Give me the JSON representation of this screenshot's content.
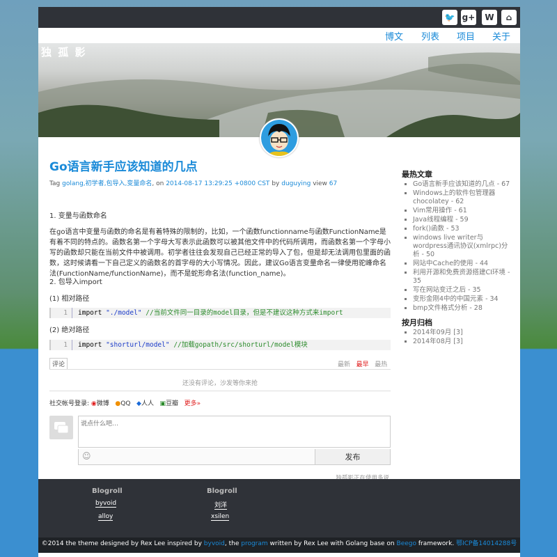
{
  "header": {
    "social": [
      {
        "icon": "twitter-icon",
        "glyph": "🐦"
      },
      {
        "icon": "google-plus-icon",
        "glyph": "g+"
      },
      {
        "icon": "weibo-icon",
        "glyph": "W"
      },
      {
        "icon": "github-icon",
        "glyph": "⌂"
      }
    ],
    "nav": [
      "博文",
      "列表",
      "项目",
      "关于"
    ],
    "logo": "独 孤 影"
  },
  "post": {
    "title": "Go语言新手应该知道的几点",
    "meta": {
      "tag_label": "Tag",
      "tags": "golang,初学者,包导入,变量命名",
      "on": ", on",
      "date": "2014-08-17 13:29:25 +0800 CST",
      "by": "by",
      "author": "duguying",
      "view_label": "view",
      "views": "67"
    },
    "h1": "1. 变量与函数命名",
    "p1": "在go语言中变量与函数的命名是有着特殊的限制的，比如，一个函数functionname与函数FunctionName是有着不同的特点的。函数名第一个字母大写表示此函数可以被其他文件中的代码所调用，而函数名第一个字母小写的函数却只能在当前文件中被调用。初学者往往会发现自己已经正常的导入了包，但是却无法调用包里面的函数，这时候请看一下自己定义的函数名的首字母的大小写情况。因此，建议Go语言变量命名一律使用驼峰命名法(FunctionName/functionName)，而不是蛇形命名法(function_name)。",
    "h2": "2. 包导入import",
    "h3": "(1) 相对路径",
    "code1": {
      "line": "1",
      "kw": "import",
      "str": "\"./model\"",
      "comment": "//当前文件同一目录的model目录，但是不建议这种方式来import"
    },
    "h4": "(2) 绝对路径",
    "code2": {
      "line": "1",
      "kw": "import",
      "str": "\"shorturl/model\"",
      "comment": "//加载gopath/src/shorturl/model模块"
    }
  },
  "comments": {
    "tab": "评论",
    "sort": [
      "最新",
      "最早",
      "最热"
    ],
    "empty": "还没有评论，沙发等你来抢",
    "social_login": "社交帐号登录:",
    "providers": [
      "微博",
      "QQ",
      "人人",
      "豆瓣",
      "更多»"
    ],
    "placeholder": "说点什么吧…",
    "submit": "发布",
    "powered": "独孤影正在使用多说"
  },
  "sidebar": {
    "hot_title": "最热文章",
    "hot": [
      "Go语言新手应该知道的几点 - 67",
      "Windows上的软件包管理器chocolatey - 62",
      "Vim常用操作 - 61",
      "Java线程编程 - 59",
      "fork()函数 - 53",
      "windows live writer与wordpress通讯协议(xmlrpc)分析 - 50",
      "网站中Cache的使用 - 44",
      "利用开源和免费资源搭建CI环境 - 35",
      "写在网站变迁之后 - 35",
      "变形金刚4中的中国元素 - 34",
      "bmp文件格式分析 - 28"
    ],
    "archive_title": "按月归档",
    "archive": [
      "2014年09月 [3]",
      "2014年08月 [3]"
    ]
  },
  "footer": {
    "blogroll1": {
      "title": "Blogroll",
      "links": [
        "byvoid",
        "alloy"
      ]
    },
    "blogroll2": {
      "title": "Blogroll",
      "links": [
        "刘洋",
        "xsilen"
      ]
    },
    "copy": {
      "a": "©2014 the theme designed by Rex Lee inspired by",
      "byvoid": "byvoid",
      "b": ", the",
      "program": "program",
      "c": "written by Rex Lee with Golang base on",
      "beego": "Beego",
      "d": "framework.",
      "icp": "鄂ICP备14014288号"
    }
  },
  "colors": {
    "accent": "#1a8ad8",
    "dark": "#2f3238",
    "hot": "#e02020"
  }
}
